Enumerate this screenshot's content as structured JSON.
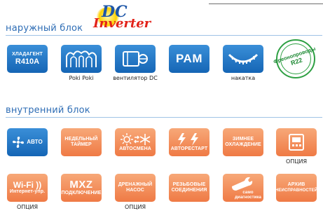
{
  "sections": {
    "outdoor": "наружный блок",
    "indoor": "внутренний блок"
  },
  "logo": {
    "dc": "DC",
    "inverter": "Inverter"
  },
  "outdoor_features": {
    "refrigerant": {
      "line1": "ХЛАДАГЕНТ",
      "line2": "R410A"
    },
    "poki_caption": "Poki Poki",
    "fan_caption": "вентилятор DC",
    "pam": "PAM",
    "nakatka_caption": "накатка",
    "stamp": {
      "line1": "Фреонопроводы",
      "line2": "R22"
    }
  },
  "indoor_features": {
    "auto": "АВТО",
    "weekly_timer": {
      "line1": "НЕДЕЛЬНЫЙ",
      "line2": "ТАЙМЕР"
    },
    "autoswitch": "АВТОСМЕНА",
    "autorestart": "АВТОРЕСТАРТ",
    "winter_cooling": {
      "line1": "ЗИМНЕЕ",
      "line2": "ОХЛАЖДЕНИЕ"
    },
    "option_caption_1": "ОПЦИЯ",
    "wifi": {
      "line1": "Wi-Fi",
      "line2": "Интернет-упр."
    },
    "mxz": {
      "line1": "MXZ",
      "line2": "ПОДКЛЮЧЕНИЕ"
    },
    "drain_pump": {
      "line1": "ДРЕНАЖНЫЙ",
      "line2": "НАСОС"
    },
    "threaded": {
      "line1": "РЕЗЬБОВЫЕ",
      "line2": "СОЕДИНЕНИЯ"
    },
    "self_diag": {
      "line1": "само",
      "line2": "диагностика"
    },
    "fault_archive": {
      "line1": "АРХИВ",
      "line2": "НЕИСПРАВНОСТЕЙ"
    },
    "option_caption_2": "ОПЦИЯ",
    "option_caption_3": "ОПЦИЯ"
  },
  "colors": {
    "blue": "#1f6fc0",
    "orange": "#f08a52",
    "green": "#2ea043",
    "title": "#2e6db5"
  }
}
